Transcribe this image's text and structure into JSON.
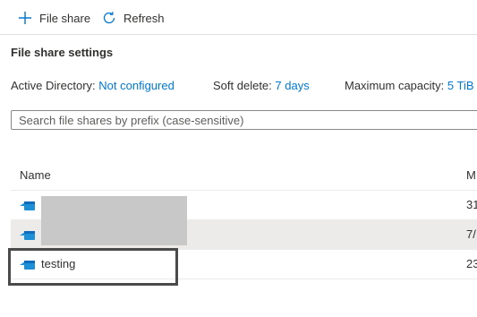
{
  "toolbar": {
    "add_label": "File share",
    "refresh_label": "Refresh"
  },
  "settings": {
    "title": "File share settings",
    "active_directory_label": "Active Directory:",
    "active_directory_value": "Not configured",
    "soft_delete_label": "Soft delete:",
    "soft_delete_value": "7 days",
    "capacity_label": "Maximum capacity:",
    "capacity_value": "5 TiB"
  },
  "search": {
    "placeholder": "Search file shares by prefix (case-sensitive)",
    "value": ""
  },
  "table": {
    "columns": [
      "Name",
      "M"
    ],
    "rows": [
      {
        "name": "",
        "modified": "31",
        "redacted": true,
        "selected": false
      },
      {
        "name": "",
        "modified": "7/",
        "redacted": true,
        "selected": true
      },
      {
        "name": "testing",
        "modified": "23",
        "redacted": false,
        "selected": false
      }
    ]
  },
  "colors": {
    "accent": "#0078d4",
    "row_selected": "#edebe9",
    "highlight_border": "#4a4a4a"
  },
  "icons": {
    "add": "plus-icon",
    "refresh": "refresh-icon",
    "file_share": "file-share-icon"
  }
}
